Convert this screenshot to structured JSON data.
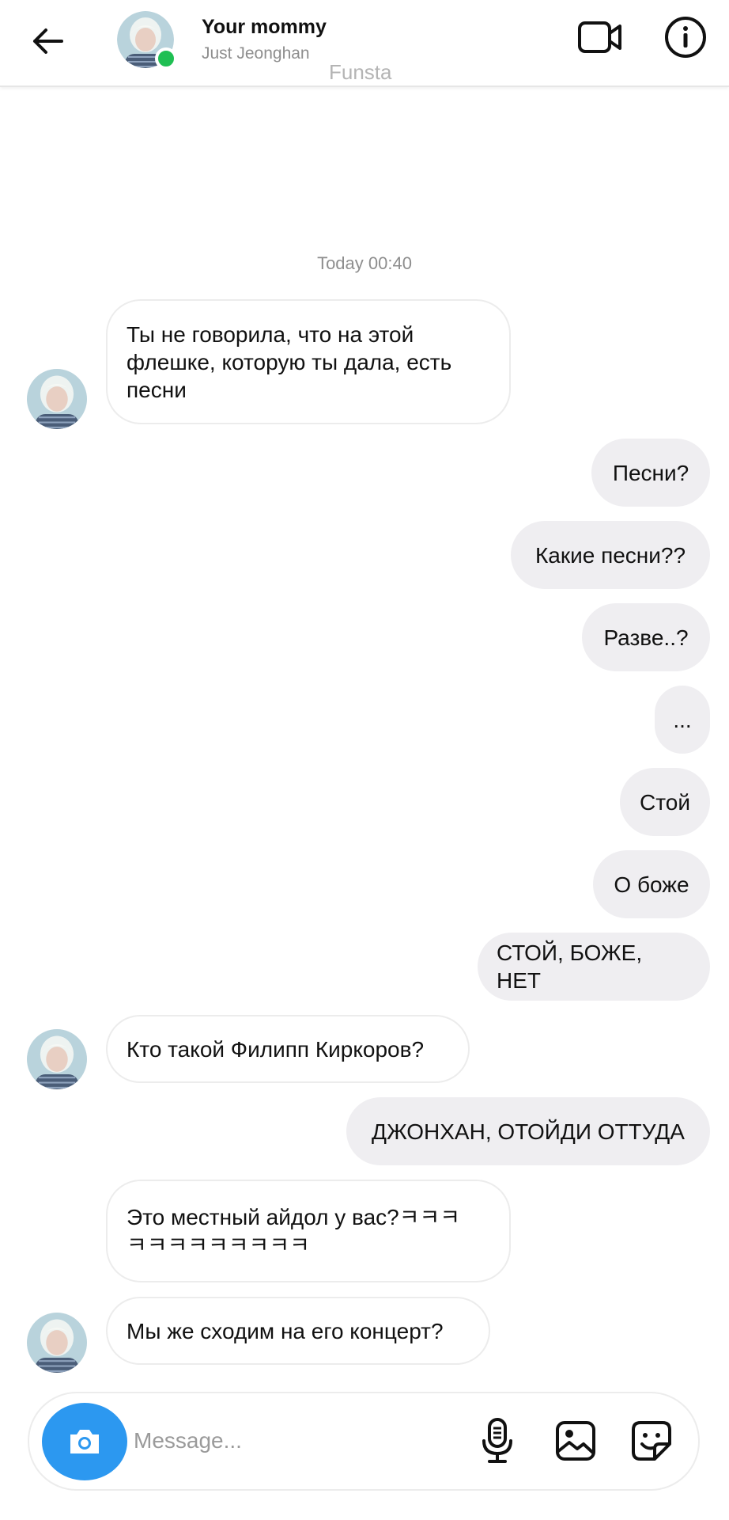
{
  "header": {
    "title": "Your mommy",
    "subtitle": "Just Jeonghan",
    "watermark": "Funsta",
    "online": true
  },
  "chat": {
    "timestamp": "Today 00:40",
    "messages": [
      {
        "from": "them",
        "text": "Ты не говорила, что на этой\nфлешке, которую ты дала, есть\nпесни"
      },
      {
        "from": "me",
        "text": "Песни?"
      },
      {
        "from": "me",
        "text": "Какие песни??"
      },
      {
        "from": "me",
        "text": "Разве..?"
      },
      {
        "from": "me",
        "text": "..."
      },
      {
        "from": "me",
        "text": "Стой"
      },
      {
        "from": "me",
        "text": "О боже"
      },
      {
        "from": "me",
        "text": "СТОЙ, БОЖЕ, НЕТ"
      },
      {
        "from": "them",
        "text": "Кто такой Филипп Киркоров?"
      },
      {
        "from": "me",
        "text": "ДЖОНХАН, ОТОЙДИ ОТТУДА"
      },
      {
        "from": "them",
        "text": "Это местный айдол у вас?ㅋㅋㅋ\nㅋㅋㅋㅋㅋㅋㅋㅋㅋ"
      },
      {
        "from": "them",
        "text": "Мы же сходим на его концерт?"
      }
    ]
  },
  "composer": {
    "placeholder": "Message...",
    "value": ""
  },
  "icons": {
    "back": "arrow-left-icon",
    "video": "video-camera-icon",
    "info": "info-icon",
    "camera": "camera-icon",
    "mic": "microphone-icon",
    "gallery": "image-icon",
    "sticker": "sticker-icon"
  },
  "colors": {
    "online_dot": "#1fbf53",
    "camera_button": "#2c98f0",
    "outgoing_bubble": "#efeef1",
    "incoming_border": "#ececec",
    "secondary_text": "#8e8e8e"
  }
}
